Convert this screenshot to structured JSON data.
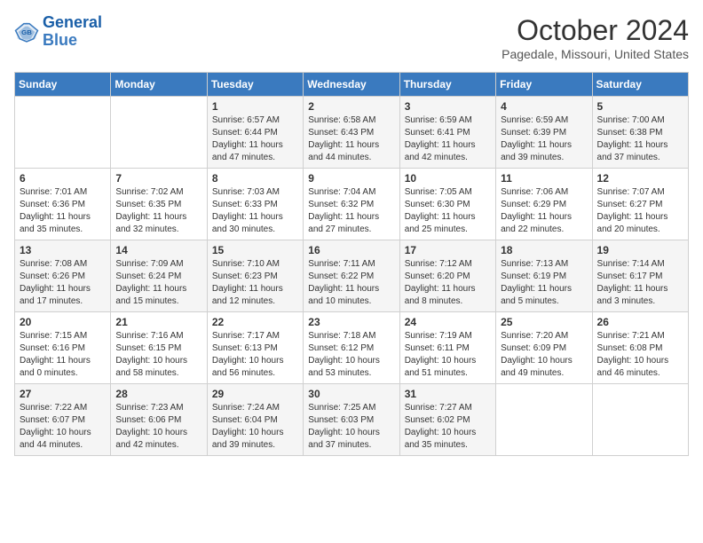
{
  "header": {
    "logo_line1": "General",
    "logo_line2": "Blue",
    "month": "October 2024",
    "location": "Pagedale, Missouri, United States"
  },
  "weekdays": [
    "Sunday",
    "Monday",
    "Tuesday",
    "Wednesday",
    "Thursday",
    "Friday",
    "Saturday"
  ],
  "weeks": [
    [
      {
        "day": "",
        "info": ""
      },
      {
        "day": "",
        "info": ""
      },
      {
        "day": "1",
        "info": "Sunrise: 6:57 AM\nSunset: 6:44 PM\nDaylight: 11 hours and 47 minutes."
      },
      {
        "day": "2",
        "info": "Sunrise: 6:58 AM\nSunset: 6:43 PM\nDaylight: 11 hours and 44 minutes."
      },
      {
        "day": "3",
        "info": "Sunrise: 6:59 AM\nSunset: 6:41 PM\nDaylight: 11 hours and 42 minutes."
      },
      {
        "day": "4",
        "info": "Sunrise: 6:59 AM\nSunset: 6:39 PM\nDaylight: 11 hours and 39 minutes."
      },
      {
        "day": "5",
        "info": "Sunrise: 7:00 AM\nSunset: 6:38 PM\nDaylight: 11 hours and 37 minutes."
      }
    ],
    [
      {
        "day": "6",
        "info": "Sunrise: 7:01 AM\nSunset: 6:36 PM\nDaylight: 11 hours and 35 minutes."
      },
      {
        "day": "7",
        "info": "Sunrise: 7:02 AM\nSunset: 6:35 PM\nDaylight: 11 hours and 32 minutes."
      },
      {
        "day": "8",
        "info": "Sunrise: 7:03 AM\nSunset: 6:33 PM\nDaylight: 11 hours and 30 minutes."
      },
      {
        "day": "9",
        "info": "Sunrise: 7:04 AM\nSunset: 6:32 PM\nDaylight: 11 hours and 27 minutes."
      },
      {
        "day": "10",
        "info": "Sunrise: 7:05 AM\nSunset: 6:30 PM\nDaylight: 11 hours and 25 minutes."
      },
      {
        "day": "11",
        "info": "Sunrise: 7:06 AM\nSunset: 6:29 PM\nDaylight: 11 hours and 22 minutes."
      },
      {
        "day": "12",
        "info": "Sunrise: 7:07 AM\nSunset: 6:27 PM\nDaylight: 11 hours and 20 minutes."
      }
    ],
    [
      {
        "day": "13",
        "info": "Sunrise: 7:08 AM\nSunset: 6:26 PM\nDaylight: 11 hours and 17 minutes."
      },
      {
        "day": "14",
        "info": "Sunrise: 7:09 AM\nSunset: 6:24 PM\nDaylight: 11 hours and 15 minutes."
      },
      {
        "day": "15",
        "info": "Sunrise: 7:10 AM\nSunset: 6:23 PM\nDaylight: 11 hours and 12 minutes."
      },
      {
        "day": "16",
        "info": "Sunrise: 7:11 AM\nSunset: 6:22 PM\nDaylight: 11 hours and 10 minutes."
      },
      {
        "day": "17",
        "info": "Sunrise: 7:12 AM\nSunset: 6:20 PM\nDaylight: 11 hours and 8 minutes."
      },
      {
        "day": "18",
        "info": "Sunrise: 7:13 AM\nSunset: 6:19 PM\nDaylight: 11 hours and 5 minutes."
      },
      {
        "day": "19",
        "info": "Sunrise: 7:14 AM\nSunset: 6:17 PM\nDaylight: 11 hours and 3 minutes."
      }
    ],
    [
      {
        "day": "20",
        "info": "Sunrise: 7:15 AM\nSunset: 6:16 PM\nDaylight: 11 hours and 0 minutes."
      },
      {
        "day": "21",
        "info": "Sunrise: 7:16 AM\nSunset: 6:15 PM\nDaylight: 10 hours and 58 minutes."
      },
      {
        "day": "22",
        "info": "Sunrise: 7:17 AM\nSunset: 6:13 PM\nDaylight: 10 hours and 56 minutes."
      },
      {
        "day": "23",
        "info": "Sunrise: 7:18 AM\nSunset: 6:12 PM\nDaylight: 10 hours and 53 minutes."
      },
      {
        "day": "24",
        "info": "Sunrise: 7:19 AM\nSunset: 6:11 PM\nDaylight: 10 hours and 51 minutes."
      },
      {
        "day": "25",
        "info": "Sunrise: 7:20 AM\nSunset: 6:09 PM\nDaylight: 10 hours and 49 minutes."
      },
      {
        "day": "26",
        "info": "Sunrise: 7:21 AM\nSunset: 6:08 PM\nDaylight: 10 hours and 46 minutes."
      }
    ],
    [
      {
        "day": "27",
        "info": "Sunrise: 7:22 AM\nSunset: 6:07 PM\nDaylight: 10 hours and 44 minutes."
      },
      {
        "day": "28",
        "info": "Sunrise: 7:23 AM\nSunset: 6:06 PM\nDaylight: 10 hours and 42 minutes."
      },
      {
        "day": "29",
        "info": "Sunrise: 7:24 AM\nSunset: 6:04 PM\nDaylight: 10 hours and 39 minutes."
      },
      {
        "day": "30",
        "info": "Sunrise: 7:25 AM\nSunset: 6:03 PM\nDaylight: 10 hours and 37 minutes."
      },
      {
        "day": "31",
        "info": "Sunrise: 7:27 AM\nSunset: 6:02 PM\nDaylight: 10 hours and 35 minutes."
      },
      {
        "day": "",
        "info": ""
      },
      {
        "day": "",
        "info": ""
      }
    ]
  ]
}
